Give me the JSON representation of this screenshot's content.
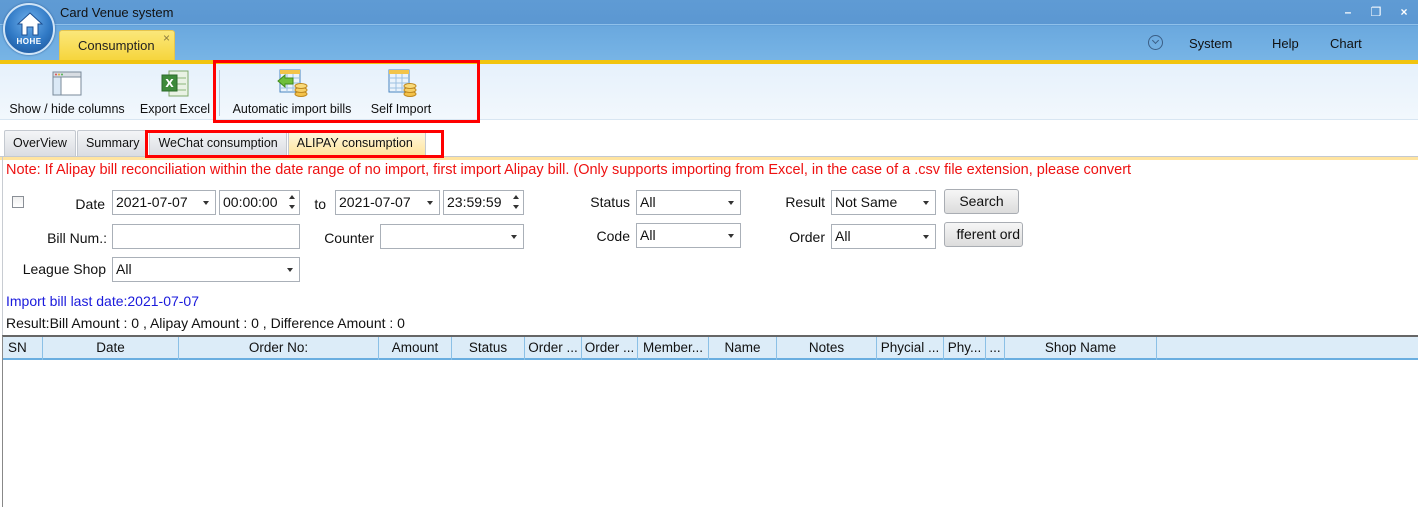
{
  "app": {
    "title": "Card Venue system",
    "logo_text": "HOHE",
    "open_tab": "Consumption",
    "tab_close": "×",
    "window_buttons": [
      "–",
      "❐",
      "×"
    ],
    "menu": [
      "System",
      "Help",
      "Chart"
    ]
  },
  "toolbar": {
    "show_hide_columns": "Show / hide columns",
    "export_excel": "Export Excel",
    "automatic_import_bills": "Automatic import bills",
    "self_import": "Self Import"
  },
  "subtabs": [
    {
      "label": "OverView",
      "active": false
    },
    {
      "label": "Summary",
      "active": false
    },
    {
      "label": "WeChat consumption",
      "active": false
    },
    {
      "label": "ALIPAY consumption",
      "active": true
    }
  ],
  "note": "Note: If Alipay bill reconciliation within the date range of no import, first import Alipay bill. (Only supports importing from Excel, in the case of a .csv file extension, please convert",
  "form": {
    "date_checkbox_checked": false,
    "date_label": "Date",
    "date_from": "2021-07-07",
    "time_from": "00:00:00",
    "to_label": "to",
    "date_to": "2021-07-07",
    "time_to": "23:59:59",
    "bill_num_label": "Bill Num.:",
    "bill_num_value": "",
    "counter_label": "Counter",
    "counter_value": "",
    "league_shop_label": "League Shop",
    "league_shop_value": "All",
    "status_label": "Status",
    "status_value": "All",
    "code_label": "Code",
    "code_value": "All",
    "result_label": "Result",
    "result_value": "Not Same",
    "order_label": "Order",
    "order_value": "All",
    "search_button": "Search",
    "different_order_button": "fferent ord"
  },
  "import_last_date": "Import bill last date:2021-07-07",
  "result_summary": "Result:Bill Amount : 0 , Alipay Amount : 0 , Difference Amount : 0",
  "grid": {
    "columns": [
      "SN",
      "Date",
      "Order No:",
      "Amount",
      "Status",
      "Order ...",
      "Order ...",
      "Member...",
      "Name",
      "Notes",
      "Phycial ...",
      "Phy...",
      "...",
      "Shop Name"
    ],
    "rows": []
  },
  "colors": {
    "accent_gold": "#f1c40f",
    "title_blue": "#5b97d2",
    "note_red": "#ee1111",
    "highlight_red": "#ff0000",
    "link_blue": "#1a1adc",
    "grid_header": "#dcecf8"
  }
}
